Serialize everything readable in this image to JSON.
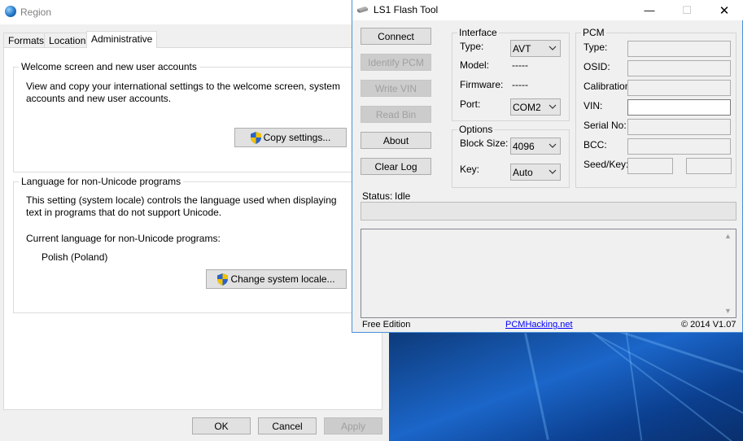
{
  "region": {
    "title": "Region",
    "tabs": [
      "Formats",
      "Location",
      "Administrative"
    ],
    "welcome": {
      "title": "Welcome screen and new user accounts",
      "line1": "View and copy your international settings to the welcome screen, system",
      "line2": "accounts and new user accounts.",
      "button": "Copy settings..."
    },
    "language": {
      "title": "Language for non-Unicode programs",
      "line1": "This setting (system locale) controls the language used when displaying",
      "line2": "text in programs that do not support Unicode.",
      "current_label": "Current language for non-Unicode programs:",
      "current_value": "Polish (Poland)",
      "button": "Change system locale..."
    },
    "buttons": {
      "ok": "OK",
      "cancel": "Cancel",
      "apply": "Apply"
    }
  },
  "ls1": {
    "title": "LS1 Flash Tool",
    "controls": {
      "minimize": "—",
      "maximize": "☐",
      "close": "✕"
    },
    "buttons": {
      "connect": "Connect",
      "identify": "Identify PCM",
      "write_vin": "Write VIN",
      "read_bin": "Read Bin",
      "about": "About",
      "clear_log": "Clear Log"
    },
    "interface": {
      "legend": "Interface",
      "type_label": "Type:",
      "type_value": "AVT",
      "model_label": "Model:",
      "model_value": "-----",
      "firmware_label": "Firmware:",
      "firmware_value": "-----",
      "port_label": "Port:",
      "port_value": "COM2"
    },
    "options": {
      "legend": "Options",
      "block_label": "Block Size:",
      "block_value": "4096",
      "key_label": "Key:",
      "key_value": "Auto"
    },
    "pcm": {
      "legend": "PCM",
      "type_label": "Type:",
      "osid_label": "OSID:",
      "calibration_label": "Calibration:",
      "vin_label": "VIN:",
      "serial_label": "Serial No:",
      "bcc_label": "BCC:",
      "seedkey_label": "Seed/Key:"
    },
    "status_label": "Status:",
    "status_value": "Idle",
    "footer": {
      "edition": "Free Edition",
      "link": "PCMHacking.net",
      "copyright": "© 2014 V1.07"
    }
  }
}
